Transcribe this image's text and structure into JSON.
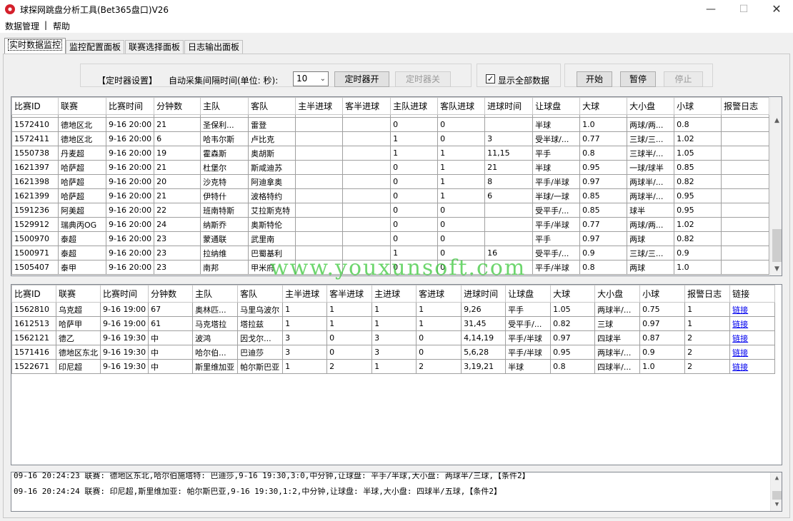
{
  "window": {
    "title": "球探网跳盘分析工具(Bet365盘口)V26",
    "min_glyph": "—",
    "max_glyph": "☐",
    "close_glyph": "✕"
  },
  "menu": {
    "items": [
      "数据管理",
      "帮助"
    ],
    "separator": "|"
  },
  "tabs": [
    "实时数据监控",
    "监控配置面板",
    "联赛选择面板",
    "日志输出面板"
  ],
  "timer": {
    "title": "【定时器设置】",
    "interval_label": "自动采集间隔时间(单位: 秒):",
    "interval_value": "10",
    "start_label": "定时器开",
    "stop_label": "定时器关"
  },
  "show_all": {
    "label": "显示全部数据",
    "checked_glyph": "✓"
  },
  "controls": {
    "start": "开始",
    "pause": "暂停",
    "stop": "停止"
  },
  "top_grid": {
    "columns": [
      "比赛ID",
      "联赛",
      "比赛时间",
      "分钟数",
      "主队",
      "客队",
      "主半进球",
      "客半进球",
      "主队进球",
      "客队进球",
      "进球时间",
      "让球盘",
      "大球",
      "大小盘",
      "小球",
      "报警日志"
    ],
    "rows": [
      [
        "1572410",
        "德地区北",
        "9-16 20:00",
        "21",
        "圣保利...",
        "雷登",
        "",
        "",
        "0",
        "0",
        "",
        "半球",
        "1.0",
        "两球/两...",
        "0.8",
        ""
      ],
      [
        "1572411",
        "德地区北",
        "9-16 20:00",
        "6",
        "哈韦尔斯",
        "卢比克",
        "",
        "",
        "1",
        "0",
        "3",
        "受半球/...",
        "0.77",
        "三球/三...",
        "1.02",
        ""
      ],
      [
        "1550738",
        "丹麦超",
        "9-16 20:00",
        "19",
        "霍森斯",
        "奥胡斯",
        "",
        "",
        "1",
        "1",
        "11,15",
        "平手",
        "0.8",
        "三球半/...",
        "1.05",
        ""
      ],
      [
        "1621397",
        "哈萨超",
        "9-16 20:00",
        "21",
        "杜堡尔",
        "斯咸迪苏",
        "",
        "",
        "0",
        "1",
        "21",
        "半球",
        "0.95",
        "一球/球半",
        "0.85",
        ""
      ],
      [
        "1621398",
        "哈萨超",
        "9-16 20:00",
        "20",
        "沙克特",
        "阿迪拿奥",
        "",
        "",
        "0",
        "1",
        "8",
        "平手/半球",
        "0.97",
        "两球半/...",
        "0.82",
        ""
      ],
      [
        "1621399",
        "哈萨超",
        "9-16 20:00",
        "21",
        "伊特什",
        "波格特约",
        "",
        "",
        "0",
        "1",
        "6",
        "半球/一球",
        "0.85",
        "两球半/...",
        "0.95",
        ""
      ],
      [
        "1591236",
        "阿美超",
        "9-16 20:00",
        "22",
        "班南特斯",
        "艾拉斯克特",
        "",
        "",
        "0",
        "0",
        "",
        "受平手/...",
        "0.85",
        "球半",
        "0.95",
        ""
      ],
      [
        "1529912",
        "瑞典丙OG",
        "9-16 20:00",
        "24",
        "纳斯乔",
        "奥斯特伦",
        "",
        "",
        "0",
        "0",
        "",
        "平手/半球",
        "0.77",
        "两球/两...",
        "1.02",
        ""
      ],
      [
        "1500970",
        "泰超",
        "9-16 20:00",
        "23",
        "蒙通联",
        "武里南",
        "",
        "",
        "0",
        "0",
        "",
        "平手",
        "0.97",
        "两球",
        "0.82",
        ""
      ],
      [
        "1500971",
        "泰超",
        "9-16 20:00",
        "23",
        "拉纳维",
        "巴蜀基利",
        "",
        "",
        "1",
        "0",
        "16",
        "受平手/...",
        "0.9",
        "三球/三...",
        "0.9",
        ""
      ],
      [
        "1505407",
        "泰甲",
        "9-16 20:00",
        "23",
        "南邦",
        "甲米府",
        "",
        "",
        "0",
        "0",
        "",
        "平手/半球",
        "0.8",
        "两球",
        "1.0",
        ""
      ]
    ]
  },
  "bottom_grid": {
    "columns": [
      "比赛ID",
      "联赛",
      "比赛时间",
      "分钟数",
      "主队",
      "客队",
      "主半进球",
      "客半进球",
      "主进球",
      "客进球",
      "进球时间",
      "让球盘",
      "大球",
      "大小盘",
      "小球",
      "报警日志",
      "链接"
    ],
    "link_text": "链接",
    "rows": [
      [
        "1562810",
        "乌克超",
        "9-16 19:00",
        "67",
        "奥林匹...",
        "马里乌波尔",
        "1",
        "1",
        "1",
        "1",
        "9,26",
        "平手",
        "1.05",
        "两球半/...",
        "0.75",
        "1"
      ],
      [
        "1612513",
        "哈萨甲",
        "9-16 19:00",
        "61",
        "马克塔拉",
        "塔拉兹",
        "1",
        "1",
        "1",
        "1",
        "31,45",
        "受平手/...",
        "0.82",
        "三球",
        "0.97",
        "1"
      ],
      [
        "1562121",
        "德乙",
        "9-16 19:30",
        "中",
        "波鸿",
        "因戈尔...",
        "3",
        "0",
        "3",
        "0",
        "4,14,19",
        "平手/半球",
        "0.97",
        "四球半",
        "0.87",
        "2"
      ],
      [
        "1571416",
        "德地区东北",
        "9-16 19:30",
        "中",
        "哈尔伯...",
        "巴迪莎",
        "3",
        "0",
        "3",
        "0",
        "5,6,28",
        "平手/半球",
        "0.95",
        "两球半/...",
        "0.9",
        "2"
      ],
      [
        "1522671",
        "印尼超",
        "9-16 19:30",
        "中",
        "斯里维加亚",
        "帕尔斯巴亚",
        "1",
        "2",
        "1",
        "2",
        "3,19,21",
        "半球",
        "0.8",
        "四球半/...",
        "1.0",
        "2"
      ]
    ]
  },
  "log": {
    "lines": [
      "09-16 20:24:23 联赛: 德地区东北,哈尔伯施塔特: 巴迪莎,9-16 19:30,3:0,中分钟,让球盘: 平手/半球,大小盘: 两球半/三球,【条件2】",
      "09-16 20:24:24 联赛: 印尼超,斯里维加亚: 帕尔斯巴亚,9-16 19:30,1:2,中分钟,让球盘: 半球,大小盘: 四球半/五球,【条件2】"
    ]
  },
  "watermark": "www.youxunsoft.com",
  "scroll_glyphs": {
    "up": "▲",
    "down": "▼"
  }
}
